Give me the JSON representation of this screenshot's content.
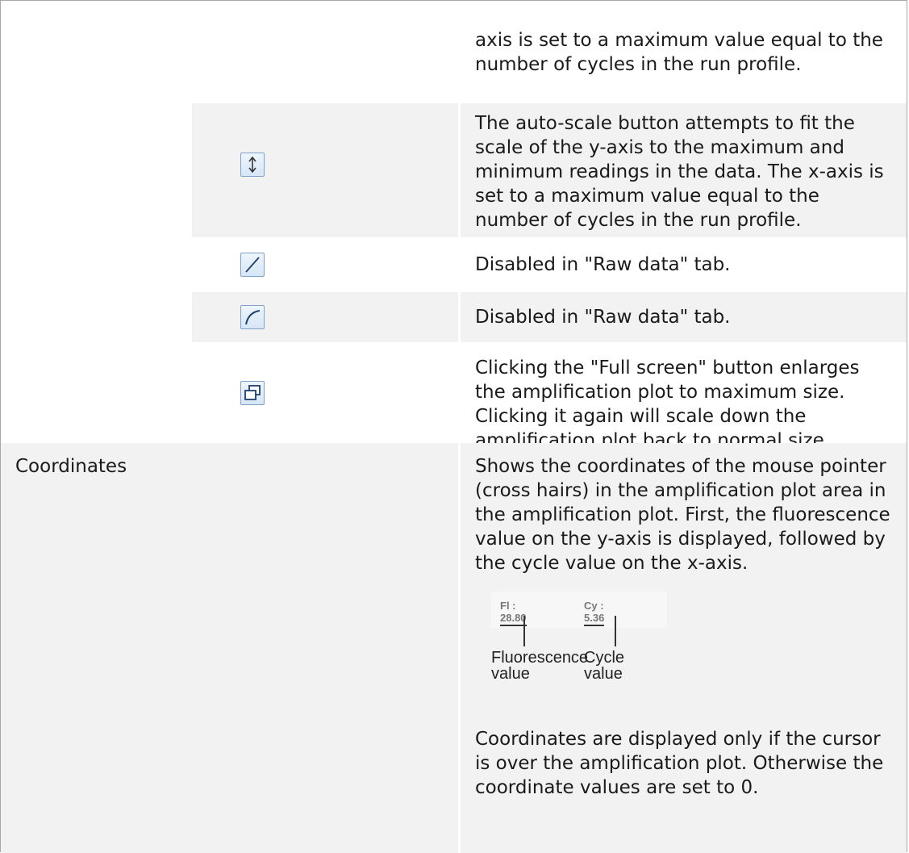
{
  "rows": {
    "row1_text": "axis is set to a maximum value equal to the number of cycles in the run profile.",
    "autoscale_text": "The auto-scale button attempts to fit the scale of the y-axis to the maximum and minimum readings in the data. The x-axis is set to a maximum value equal to the number of cycles in the run profile.",
    "linear_text": "Disabled in \"Raw data\" tab.",
    "log_text": "Disabled in \"Raw data\" tab.",
    "fullscreen_text": "Clicking the \"Full screen\" button enlarges the amplification plot to maximum size. Clicking it again will scale down the amplification plot back to normal size.",
    "coordinates_label": "Coordinates",
    "coordinates_text": "Shows the coordinates of the mouse pointer (cross hairs) in the amplification plot area in the amplification plot. First, the fluorescence value on the y-axis is displayed, followed by the cycle value on the x-axis.",
    "coordinates_note": "Coordinates are displayed only if the cursor is over the amplification plot. Otherwise the coordinate values are set to 0."
  },
  "figure": {
    "fl_value": "Fl : 28.80",
    "cy_value": "Cy : 5.36",
    "fl_label": "Fluorescence value",
    "cy_label": "Cycle value"
  },
  "icons": [
    "autoscale-icon",
    "linear-scale-icon",
    "log-scale-icon",
    "fullscreen-icon"
  ]
}
